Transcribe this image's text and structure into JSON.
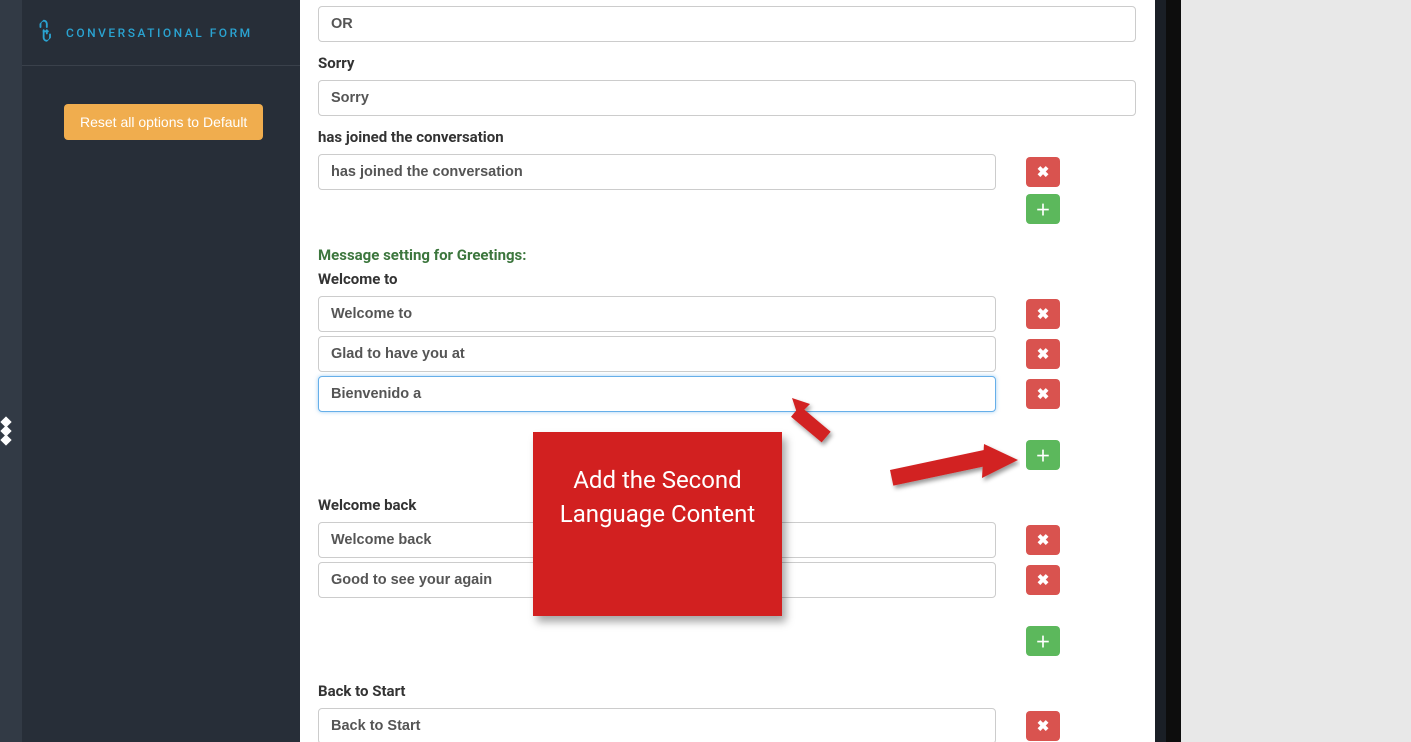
{
  "sidebar": {
    "title": "CONVERSATIONAL FORM",
    "reset_label": "Reset all options to Default"
  },
  "fields": {
    "or": {
      "label": "OR",
      "value": "OR"
    },
    "sorry": {
      "label": "Sorry",
      "value": "Sorry"
    },
    "joined": {
      "label": "has joined the conversation",
      "value": "has joined the conversation"
    }
  },
  "greetings": {
    "section_title": "Message setting for Greetings:",
    "welcome_to": {
      "label": "Welcome to",
      "items": [
        "Welcome to",
        "Glad to have you at",
        "Bienvenido a"
      ]
    },
    "welcome_back": {
      "label": "Welcome back",
      "items": [
        "Welcome back",
        "Good to see your again"
      ]
    },
    "back_to_start": {
      "label": "Back to Start",
      "items": [
        "Back to Start"
      ]
    }
  },
  "annotation": {
    "text": "Add the Second Language Content"
  },
  "icons": {
    "remove": "✖",
    "add": "＋",
    "plug": "🔌"
  }
}
